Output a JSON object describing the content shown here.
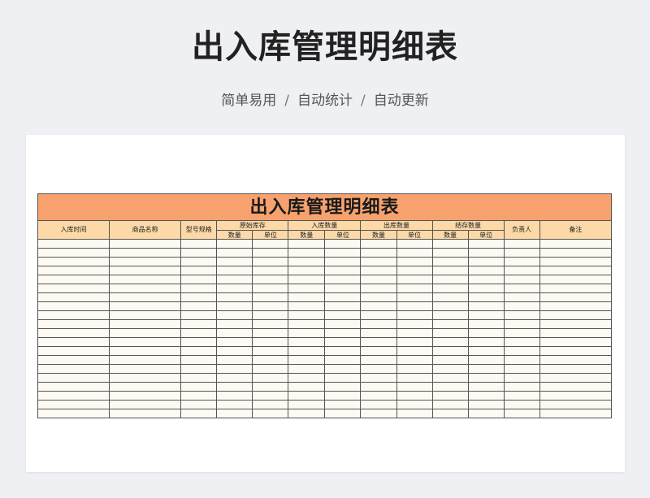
{
  "header": {
    "title": "出入库管理明细表",
    "subtitle_items": [
      "简单易用",
      "自动统计",
      "自动更新"
    ],
    "separator": "/"
  },
  "sheet": {
    "title": "出入库管理明细表",
    "columns": {
      "in_time": "入库时间",
      "product_name": "商品名称",
      "model_spec": "型号规格",
      "original_stock": "原始库存",
      "in_qty": "入库数量",
      "out_qty": "出库数量",
      "balance_qty": "结存数量",
      "person": "负责人",
      "remarks": "备注"
    },
    "sub_columns": {
      "quantity": "数量",
      "unit": "单位"
    },
    "empty_row_count": 20
  },
  "colors": {
    "title_bar": "#f7a26e",
    "header_fill": "#fcd9a7",
    "cell_fill": "#fdfaf3",
    "page_background": "#eef0f4"
  }
}
